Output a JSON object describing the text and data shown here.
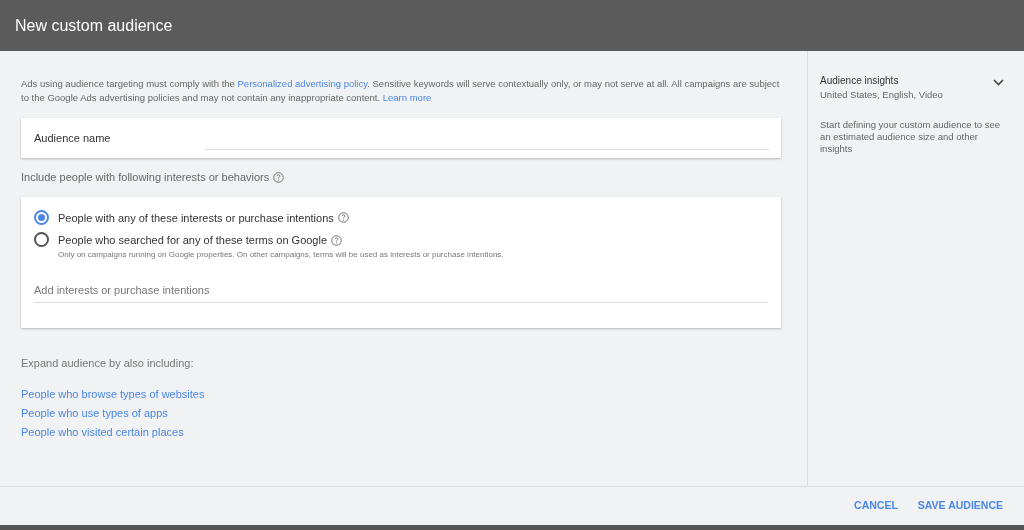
{
  "dialog": {
    "title": "New custom audience"
  },
  "notice": [
    {
      "kind": "text",
      "text": "Ads using audience targeting must comply with the "
    },
    {
      "kind": "link",
      "text": "Personalized advertising policy"
    },
    {
      "kind": "text",
      "text": ". Sensitive keywords will serve contextually only, or may not serve at all. All campaigns are subject to the Google Ads advertising policies and may not contain any inappropriate content. "
    },
    {
      "kind": "link",
      "text": "Learn more"
    }
  ],
  "audience_name": {
    "label": "Audience name"
  },
  "include": {
    "heading": "Include people with following interests or behaviors",
    "options": [
      {
        "label": "People with any of these interests or purchase intentions",
        "selected": true
      },
      {
        "label": "People who searched for any of these terms on Google",
        "hint": "Only on campaigns running on Google properties. On other campaigns, terms will be used as interests or purchase intentions.",
        "selected": false
      }
    ],
    "input": {
      "placeholder": "Add interests or purchase intentions"
    }
  },
  "expand": {
    "heading": "Expand audience by also including:",
    "links": [
      "People who browse types of websites",
      "People who use types of apps",
      "People who visited certain places"
    ]
  },
  "insights": {
    "title": "Audience insights",
    "subtitle": "United States, English, Video",
    "expanded": false,
    "description": "Start defining your custom audience to see an estimated audience size and other insights"
  },
  "buttons": [
    "CANCEL",
    "SAVE AUDIENCE"
  ]
}
